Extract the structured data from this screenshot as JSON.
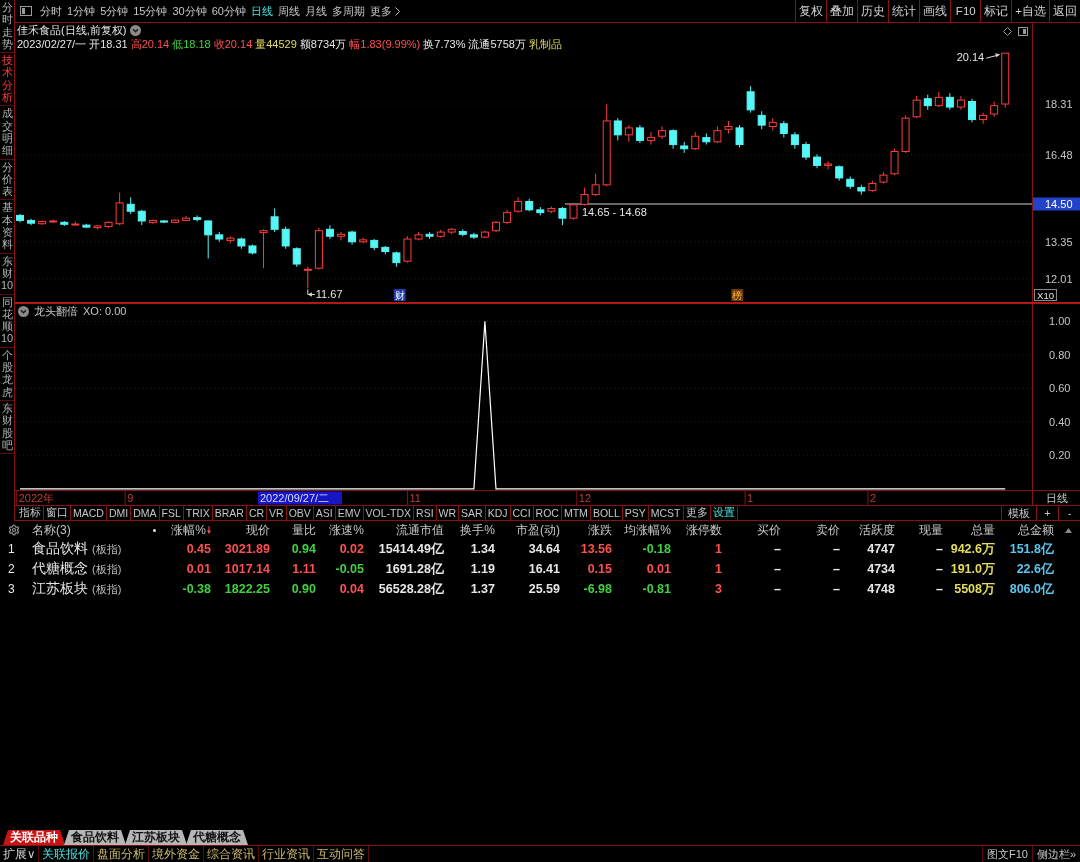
{
  "left_tabs": [
    {
      "label": "分时走势",
      "selected": false
    },
    {
      "label": "技术分析",
      "selected": true
    },
    {
      "label": "成交明细",
      "selected": false
    },
    {
      "label": "分价表",
      "selected": false
    },
    {
      "label": "基本资料",
      "selected": false
    },
    {
      "label": "东财10",
      "selected": false
    },
    {
      "label": "同花顺10",
      "selected": false
    },
    {
      "label": "个股龙虎",
      "selected": false
    },
    {
      "label": "东财股吧",
      "selected": false
    }
  ],
  "period_tabs": [
    {
      "label": "分时",
      "kind": "period",
      "selected": false
    },
    {
      "label": "1分钟",
      "kind": "period",
      "selected": false
    },
    {
      "label": "5分钟",
      "kind": "period",
      "selected": false
    },
    {
      "label": "15分钟",
      "kind": "period",
      "selected": false
    },
    {
      "label": "30分钟",
      "kind": "period",
      "selected": false
    },
    {
      "label": "60分钟",
      "kind": "period",
      "selected": false
    },
    {
      "label": "日线",
      "kind": "period",
      "selected": true
    },
    {
      "label": "周线",
      "kind": "period",
      "selected": false
    },
    {
      "label": "月线",
      "kind": "period",
      "selected": false
    },
    {
      "label": "多周期",
      "kind": "period",
      "selected": false
    },
    {
      "label": "更多",
      "kind": "menu",
      "selected": false
    }
  ],
  "tool_buttons": [
    "复权",
    "叠加",
    "历史",
    "统计",
    "画线",
    "F10",
    "标记",
    "+自选",
    "返回"
  ],
  "price_panel": {
    "title": "佳禾食品(日线,前复权)",
    "quote": [
      {
        "text": "2023/02/27/一",
        "kind": "plain"
      },
      {
        "text": "开18.31",
        "kind": "plain"
      },
      {
        "text": "高20.14",
        "kind": "up"
      },
      {
        "text": "低18.18",
        "kind": "down"
      },
      {
        "text": "收20.14",
        "kind": "up"
      },
      {
        "text": "量44529",
        "kind": "volume"
      },
      {
        "text": "额8734万",
        "kind": "plain"
      },
      {
        "text": "幅1.83(9.99%)",
        "kind": "up"
      },
      {
        "text": "换7.73%",
        "kind": "plain"
      },
      {
        "text": "流通5758万",
        "kind": "plain"
      },
      {
        "text": "乳制品",
        "kind": "sector"
      }
    ],
    "chart_data": {
      "type": "candlestick",
      "ohlc": [
        [
          14.3,
          14.35,
          14.05,
          14.12
        ],
        [
          14.12,
          14.18,
          13.95,
          14.02
        ],
        [
          14.0,
          14.12,
          13.96,
          14.08
        ],
        [
          14.08,
          14.15,
          14.02,
          14.1
        ],
        [
          14.05,
          14.1,
          13.92,
          13.98
        ],
        [
          13.98,
          14.08,
          13.94,
          13.99
        ],
        [
          13.95,
          14.0,
          13.85,
          13.88
        ],
        [
          13.86,
          13.95,
          13.8,
          13.92
        ],
        [
          13.9,
          14.08,
          13.85,
          14.05
        ],
        [
          14.0,
          15.12,
          13.95,
          14.75
        ],
        [
          14.7,
          14.95,
          14.35,
          14.45
        ],
        [
          14.45,
          14.5,
          13.95,
          14.1
        ],
        [
          14.05,
          14.15,
          14.0,
          14.12
        ],
        [
          14.1,
          14.14,
          14.02,
          14.06
        ],
        [
          14.05,
          14.16,
          14.03,
          14.13
        ],
        [
          14.12,
          14.28,
          14.1,
          14.2
        ],
        [
          14.22,
          14.3,
          14.08,
          14.15
        ],
        [
          14.1,
          14.12,
          12.75,
          13.6
        ],
        [
          13.6,
          13.7,
          13.35,
          13.45
        ],
        [
          13.4,
          13.55,
          13.3,
          13.48
        ],
        [
          13.45,
          13.5,
          13.1,
          13.2
        ],
        [
          13.2,
          13.25,
          12.9,
          12.95
        ],
        [
          13.68,
          13.8,
          12.4,
          13.75
        ],
        [
          14.25,
          14.55,
          13.7,
          13.8
        ],
        [
          13.8,
          13.9,
          13.1,
          13.2
        ],
        [
          13.1,
          13.15,
          12.45,
          12.55
        ],
        [
          12.33,
          12.45,
          11.67,
          12.36
        ],
        [
          12.4,
          13.85,
          12.35,
          13.75
        ],
        [
          13.8,
          13.95,
          13.45,
          13.55
        ],
        [
          13.55,
          13.7,
          13.4,
          13.62
        ],
        [
          13.7,
          13.75,
          13.25,
          13.35
        ],
        [
          13.35,
          13.5,
          13.3,
          13.42
        ],
        [
          13.4,
          13.45,
          13.05,
          13.15
        ],
        [
          13.15,
          13.2,
          12.9,
          13.0
        ],
        [
          12.95,
          13.0,
          12.45,
          12.6
        ],
        [
          12.65,
          13.55,
          12.6,
          13.45
        ],
        [
          13.45,
          13.7,
          13.4,
          13.6
        ],
        [
          13.62,
          13.7,
          13.45,
          13.55
        ],
        [
          13.55,
          13.78,
          13.5,
          13.7
        ],
        [
          13.7,
          13.85,
          13.62,
          13.8
        ],
        [
          13.72,
          13.8,
          13.55,
          13.62
        ],
        [
          13.6,
          13.68,
          13.45,
          13.52
        ],
        [
          13.52,
          13.75,
          13.48,
          13.7
        ],
        [
          13.75,
          14.1,
          13.7,
          14.05
        ],
        [
          14.05,
          14.5,
          14.0,
          14.4
        ],
        [
          14.45,
          14.95,
          14.4,
          14.8
        ],
        [
          14.8,
          14.9,
          14.45,
          14.5
        ],
        [
          14.5,
          14.6,
          14.3,
          14.4
        ],
        [
          14.45,
          14.62,
          14.38,
          14.55
        ],
        [
          14.55,
          14.6,
          13.95,
          14.2
        ],
        [
          14.2,
          14.75,
          14.15,
          14.68
        ],
        [
          14.7,
          15.3,
          14.65,
          15.05
        ],
        [
          15.05,
          15.8,
          15.0,
          15.4
        ],
        [
          15.4,
          18.3,
          15.35,
          17.7
        ],
        [
          17.7,
          17.8,
          17.0,
          17.2
        ],
        [
          17.2,
          17.55,
          16.95,
          17.45
        ],
        [
          17.45,
          17.55,
          16.9,
          17.0
        ],
        [
          17.0,
          17.3,
          16.85,
          17.1
        ],
        [
          17.15,
          17.5,
          17.05,
          17.35
        ],
        [
          17.35,
          17.4,
          16.7,
          16.85
        ],
        [
          16.8,
          16.95,
          16.55,
          16.7
        ],
        [
          16.7,
          17.3,
          16.65,
          17.15
        ],
        [
          17.1,
          17.25,
          16.85,
          16.95
        ],
        [
          16.95,
          17.5,
          16.9,
          17.35
        ],
        [
          17.4,
          17.7,
          17.25,
          17.5
        ],
        [
          17.45,
          17.55,
          16.75,
          16.85
        ],
        [
          18.75,
          18.95,
          18.0,
          18.1
        ],
        [
          17.9,
          18.05,
          17.4,
          17.55
        ],
        [
          17.5,
          17.8,
          17.35,
          17.65
        ],
        [
          17.6,
          17.7,
          17.1,
          17.25
        ],
        [
          17.2,
          17.3,
          16.7,
          16.85
        ],
        [
          16.85,
          16.95,
          16.3,
          16.4
        ],
        [
          16.4,
          16.5,
          16.0,
          16.1
        ],
        [
          16.1,
          16.25,
          15.95,
          16.15
        ],
        [
          16.05,
          16.1,
          15.55,
          15.65
        ],
        [
          15.6,
          15.7,
          15.25,
          15.35
        ],
        [
          15.3,
          15.4,
          15.05,
          15.18
        ],
        [
          15.2,
          15.55,
          15.15,
          15.45
        ],
        [
          15.5,
          15.85,
          15.45,
          15.75
        ],
        [
          15.8,
          16.7,
          15.75,
          16.6
        ],
        [
          16.6,
          17.9,
          16.55,
          17.8
        ],
        [
          17.85,
          18.6,
          17.8,
          18.45
        ],
        [
          18.5,
          18.65,
          18.1,
          18.25
        ],
        [
          18.25,
          18.75,
          18.2,
          18.55
        ],
        [
          18.55,
          18.7,
          18.1,
          18.2
        ],
        [
          18.2,
          18.6,
          18.1,
          18.45
        ],
        [
          18.4,
          18.5,
          17.65,
          17.75
        ],
        [
          17.75,
          18.0,
          17.6,
          17.9
        ],
        [
          17.95,
          18.4,
          17.85,
          18.25
        ],
        [
          18.31,
          20.14,
          18.18,
          20.14
        ]
      ],
      "ylim": [
        11.147,
        21.226
      ],
      "yticks": [
        {
          "value": 18.31,
          "label": "18.31"
        },
        {
          "value": 16.48,
          "label": "16.48"
        },
        {
          "value": 13.35,
          "label": "13.35"
        },
        {
          "value": 12.01,
          "label": "12.01"
        }
      ],
      "grid": true
    },
    "cursor_price": "14.50",
    "scale_label": "X10",
    "annotations": [
      {
        "text": "20.14",
        "kind": "high"
      },
      {
        "text": "14.65 - 14.68",
        "kind": "cursor"
      },
      {
        "text": "11.67",
        "kind": "low"
      }
    ],
    "event_marks": [
      {
        "text": "财",
        "kind": "finance"
      },
      {
        "text": "榜",
        "kind": "rank"
      }
    ]
  },
  "indicator_panel": {
    "reading": "XO: 0.00",
    "chart_data": {
      "type": "line",
      "title": "龙头翻倍",
      "ylim": [
        -0.09,
        1.11
      ],
      "yticks": [
        {
          "value": 1,
          "label": "1.00"
        },
        {
          "value": 0.8,
          "label": "0.80"
        },
        {
          "value": 0.6,
          "label": "0.60"
        },
        {
          "value": 0.4,
          "label": "0.40"
        },
        {
          "value": 0.2,
          "label": "0.20"
        }
      ],
      "grid": true,
      "series": [
        {
          "color": "#ffffff",
          "values": [
            0,
            0,
            0,
            0,
            0,
            0,
            0,
            0,
            0,
            0,
            0,
            0,
            0,
            0,
            0,
            0,
            0,
            0,
            0,
            0,
            0,
            0,
            0,
            0,
            0,
            0,
            0,
            0,
            0,
            0,
            0,
            0,
            0,
            0,
            0,
            0,
            0,
            0,
            0,
            0,
            0,
            0,
            1,
            0,
            0,
            0,
            0,
            0,
            0,
            0,
            0,
            0,
            0,
            0,
            0,
            0,
            0,
            0,
            0,
            0,
            0,
            0,
            0,
            0,
            0,
            0,
            0,
            0,
            0,
            0,
            0,
            0,
            0,
            0,
            0,
            0,
            0,
            0,
            0,
            0,
            0,
            0,
            0,
            0,
            0,
            0,
            0,
            0,
            0,
            0
          ]
        }
      ]
    }
  },
  "date_axis": {
    "labels": [
      "2022年",
      "9",
      "11",
      "12",
      "1",
      "2"
    ],
    "cursor_date": "2022/09/27/二",
    "period": "日线"
  },
  "indicator_tabs": [
    {
      "label": "指标",
      "kind": "tab"
    },
    {
      "label": "窗口",
      "kind": "tab"
    },
    {
      "label": "MACD",
      "kind": "tab"
    },
    {
      "label": "DMI",
      "kind": "tab"
    },
    {
      "label": "DMA",
      "kind": "tab"
    },
    {
      "label": "FSL",
      "kind": "tab"
    },
    {
      "label": "TRIX",
      "kind": "tab"
    },
    {
      "label": "BRAR",
      "kind": "tab"
    },
    {
      "label": "CR",
      "kind": "tab"
    },
    {
      "label": "VR",
      "kind": "tab"
    },
    {
      "label": "OBV",
      "kind": "tab"
    },
    {
      "label": "ASI",
      "kind": "tab"
    },
    {
      "label": "EMV",
      "kind": "tab"
    },
    {
      "label": "VOL-TDX",
      "kind": "tab"
    },
    {
      "label": "RSI",
      "kind": "tab"
    },
    {
      "label": "WR",
      "kind": "tab"
    },
    {
      "label": "SAR",
      "kind": "tab"
    },
    {
      "label": "KDJ",
      "kind": "tab"
    },
    {
      "label": "CCI",
      "kind": "tab"
    },
    {
      "label": "ROC",
      "kind": "tab"
    },
    {
      "label": "MTM",
      "kind": "tab"
    },
    {
      "label": "BOLL",
      "kind": "tab"
    },
    {
      "label": "PSY",
      "kind": "tab"
    },
    {
      "label": "MCST",
      "kind": "tab"
    },
    {
      "label": "更多",
      "kind": "tab"
    },
    {
      "label": "设置",
      "kind": "link"
    }
  ],
  "template_buttons": [
    "模板",
    "+",
    "-"
  ],
  "table": {
    "name_header": "名称(3)",
    "columns": [
      {
        "label": "涨幅%",
        "sorted": true
      },
      {
        "label": "现价",
        "sorted": false
      },
      {
        "label": "量比",
        "sorted": false
      },
      {
        "label": "涨速%",
        "sorted": false
      },
      {
        "label": "流通市值",
        "sorted": false
      },
      {
        "label": "换手%",
        "sorted": false
      },
      {
        "label": "市盈(动)",
        "sorted": false
      },
      {
        "label": "涨跌",
        "sorted": false
      },
      {
        "label": "均涨幅%",
        "sorted": false
      },
      {
        "label": "涨停数",
        "sorted": false
      },
      {
        "label": "买价",
        "sorted": false
      },
      {
        "label": "卖价",
        "sorted": false
      },
      {
        "label": "活跃度",
        "sorted": false
      },
      {
        "label": "现量",
        "sorted": false
      },
      {
        "label": "总量",
        "sorted": false
      },
      {
        "label": "总金额",
        "sorted": false
      }
    ],
    "rows": [
      {
        "no": "1",
        "name": "食品饮料",
        "tag": "(板指)",
        "cells": [
          {
            "text": "0.45",
            "color": "#ff5050"
          },
          {
            "text": "3021.89",
            "color": "#ff5050"
          },
          {
            "text": "0.94",
            "color": "#40d040"
          },
          {
            "text": "0.02",
            "color": "#ff5050"
          },
          {
            "text": "15414.49亿",
            "color": "#e6e6e6"
          },
          {
            "text": "1.34",
            "color": "#e6e6e6"
          },
          {
            "text": "34.64",
            "color": "#e6e6e6"
          },
          {
            "text": "13.56",
            "color": "#ff5050"
          },
          {
            "text": "-0.18",
            "color": "#40d040"
          },
          {
            "text": "1",
            "color": "#ff5050"
          },
          {
            "text": "–",
            "color": "#e6e6e6"
          },
          {
            "text": "–",
            "color": "#e6e6e6"
          },
          {
            "text": "4747",
            "color": "#e6e6e6"
          },
          {
            "text": "–",
            "color": "#e6e6e6"
          },
          {
            "text": "942.6万",
            "color": "#e4dc5c"
          },
          {
            "text": "151.8亿",
            "color": "#5cc6ee"
          }
        ]
      },
      {
        "no": "2",
        "name": "代糖概念",
        "tag": "(板指)",
        "cells": [
          {
            "text": "0.01",
            "color": "#ff5050"
          },
          {
            "text": "1017.14",
            "color": "#ff5050"
          },
          {
            "text": "1.11",
            "color": "#ff5050"
          },
          {
            "text": "-0.05",
            "color": "#40d040"
          },
          {
            "text": "1691.28亿",
            "color": "#e6e6e6"
          },
          {
            "text": "1.19",
            "color": "#e6e6e6"
          },
          {
            "text": "16.41",
            "color": "#e6e6e6"
          },
          {
            "text": "0.15",
            "color": "#ff5050"
          },
          {
            "text": "0.01",
            "color": "#ff5050"
          },
          {
            "text": "1",
            "color": "#ff5050"
          },
          {
            "text": "–",
            "color": "#e6e6e6"
          },
          {
            "text": "–",
            "color": "#e6e6e6"
          },
          {
            "text": "4734",
            "color": "#e6e6e6"
          },
          {
            "text": "–",
            "color": "#e6e6e6"
          },
          {
            "text": "191.0万",
            "color": "#e4dc5c"
          },
          {
            "text": "22.6亿",
            "color": "#5cc6ee"
          }
        ]
      },
      {
        "no": "3",
        "name": "江苏板块",
        "tag": "(板指)",
        "cells": [
          {
            "text": "-0.38",
            "color": "#40d040"
          },
          {
            "text": "1822.25",
            "color": "#40d040"
          },
          {
            "text": "0.90",
            "color": "#40d040"
          },
          {
            "text": "0.04",
            "color": "#ff5050"
          },
          {
            "text": "56528.28亿",
            "color": "#e6e6e6"
          },
          {
            "text": "1.37",
            "color": "#e6e6e6"
          },
          {
            "text": "25.59",
            "color": "#e6e6e6"
          },
          {
            "text": "-6.98",
            "color": "#40d040"
          },
          {
            "text": "-0.81",
            "color": "#40d040"
          },
          {
            "text": "3",
            "color": "#ff5050"
          },
          {
            "text": "–",
            "color": "#e6e6e6"
          },
          {
            "text": "–",
            "color": "#e6e6e6"
          },
          {
            "text": "4748",
            "color": "#e6e6e6"
          },
          {
            "text": "–",
            "color": "#e6e6e6"
          },
          {
            "text": "5508万",
            "color": "#e4dc5c"
          },
          {
            "text": "806.0亿",
            "color": "#5cc6ee"
          }
        ]
      }
    ]
  },
  "bottom_tabs": [
    {
      "label": "关联品种",
      "selected": true
    },
    {
      "label": "食品饮料",
      "selected": false
    },
    {
      "label": "江苏板块",
      "selected": false
    },
    {
      "label": "代糖概念",
      "selected": false
    }
  ],
  "bottom_bar": {
    "expand": "扩展∨",
    "tabs": [
      {
        "label": "关联报价",
        "selected": true
      },
      {
        "label": "盘面分析",
        "selected": false
      },
      {
        "label": "境外资金",
        "selected": false
      },
      {
        "label": "综合资讯",
        "selected": false
      },
      {
        "label": "行业资讯",
        "selected": false
      },
      {
        "label": "互动问答",
        "selected": false
      }
    ],
    "right_buttons": [
      "图文F10",
      "侧边栏»"
    ]
  }
}
